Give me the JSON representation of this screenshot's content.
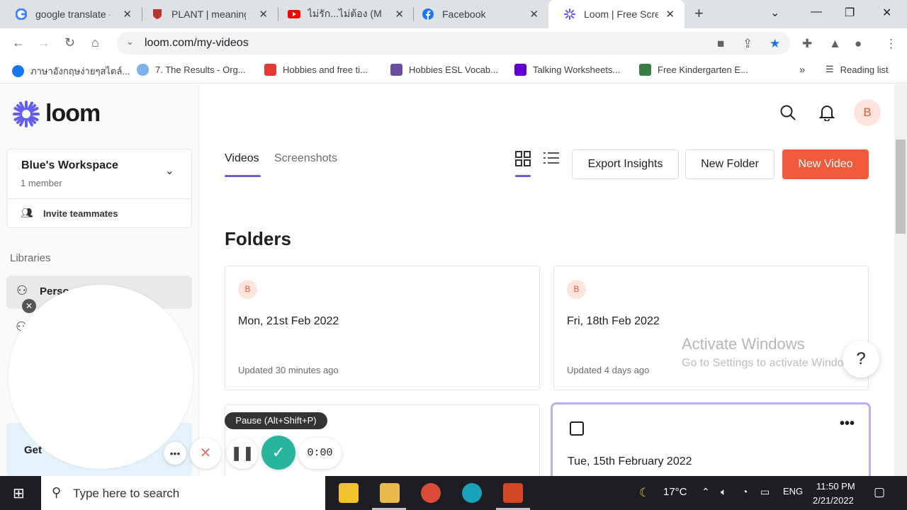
{
  "browser": {
    "tabs": [
      {
        "title": "google translate -",
        "active": false
      },
      {
        "title": "PLANT | meaning o",
        "active": false
      },
      {
        "title": "ไม่รัก...ไม่ต้อง (Mai R",
        "active": false
      },
      {
        "title": "Facebook",
        "active": false
      },
      {
        "title": "Loom | Free Screen",
        "active": true
      }
    ],
    "url": "loom.com/my-videos",
    "bookmarks": [
      "ภาษาอังกฤษง่ายๆสไตล์...",
      "7. The Results - Org...",
      "Hobbies and free ti...",
      "Hobbies ESL Vocab...",
      "Talking Worksheets...",
      "Free Kindergarten E..."
    ],
    "reading_list": "Reading list"
  },
  "sidebar": {
    "logo": "loom",
    "workspace_name": "Blue's Workspace",
    "member_count": "1 member",
    "invite": "Invite teammates",
    "libraries_heading": "Libraries",
    "library_selected": "Perso",
    "get_card": "Get"
  },
  "header": {
    "avatar_letter": "B",
    "tabs": [
      "Videos",
      "Screenshots"
    ],
    "export_label": "Export Insights",
    "new_folder_label": "New Folder",
    "new_video_label": "New Video"
  },
  "main": {
    "folders_heading": "Folders",
    "folders": [
      {
        "avatar": "B",
        "title": "Mon, 21st Feb 2022",
        "updated": "Updated 30 minutes ago"
      },
      {
        "avatar": "B",
        "title": "Fri, 18th Feb 2022",
        "updated": "Updated 4 days ago"
      }
    ],
    "partial_card_title": "Tue, 15th February 2022",
    "watermark_title": "Activate Windows",
    "watermark_sub": "Go to Settings to activate Windows.",
    "help": "?"
  },
  "recorder": {
    "tooltip": "Pause (Alt+Shift+P)",
    "timer": "0:00"
  },
  "taskbar": {
    "search_placeholder": "Type here to search",
    "temperature": "17°C",
    "language": "ENG",
    "time": "11:50 PM",
    "date": "2/21/2022"
  },
  "colors": {
    "accent": "#6a5cdc",
    "new_video": "#f15a3b",
    "record_done": "#28b59e"
  }
}
